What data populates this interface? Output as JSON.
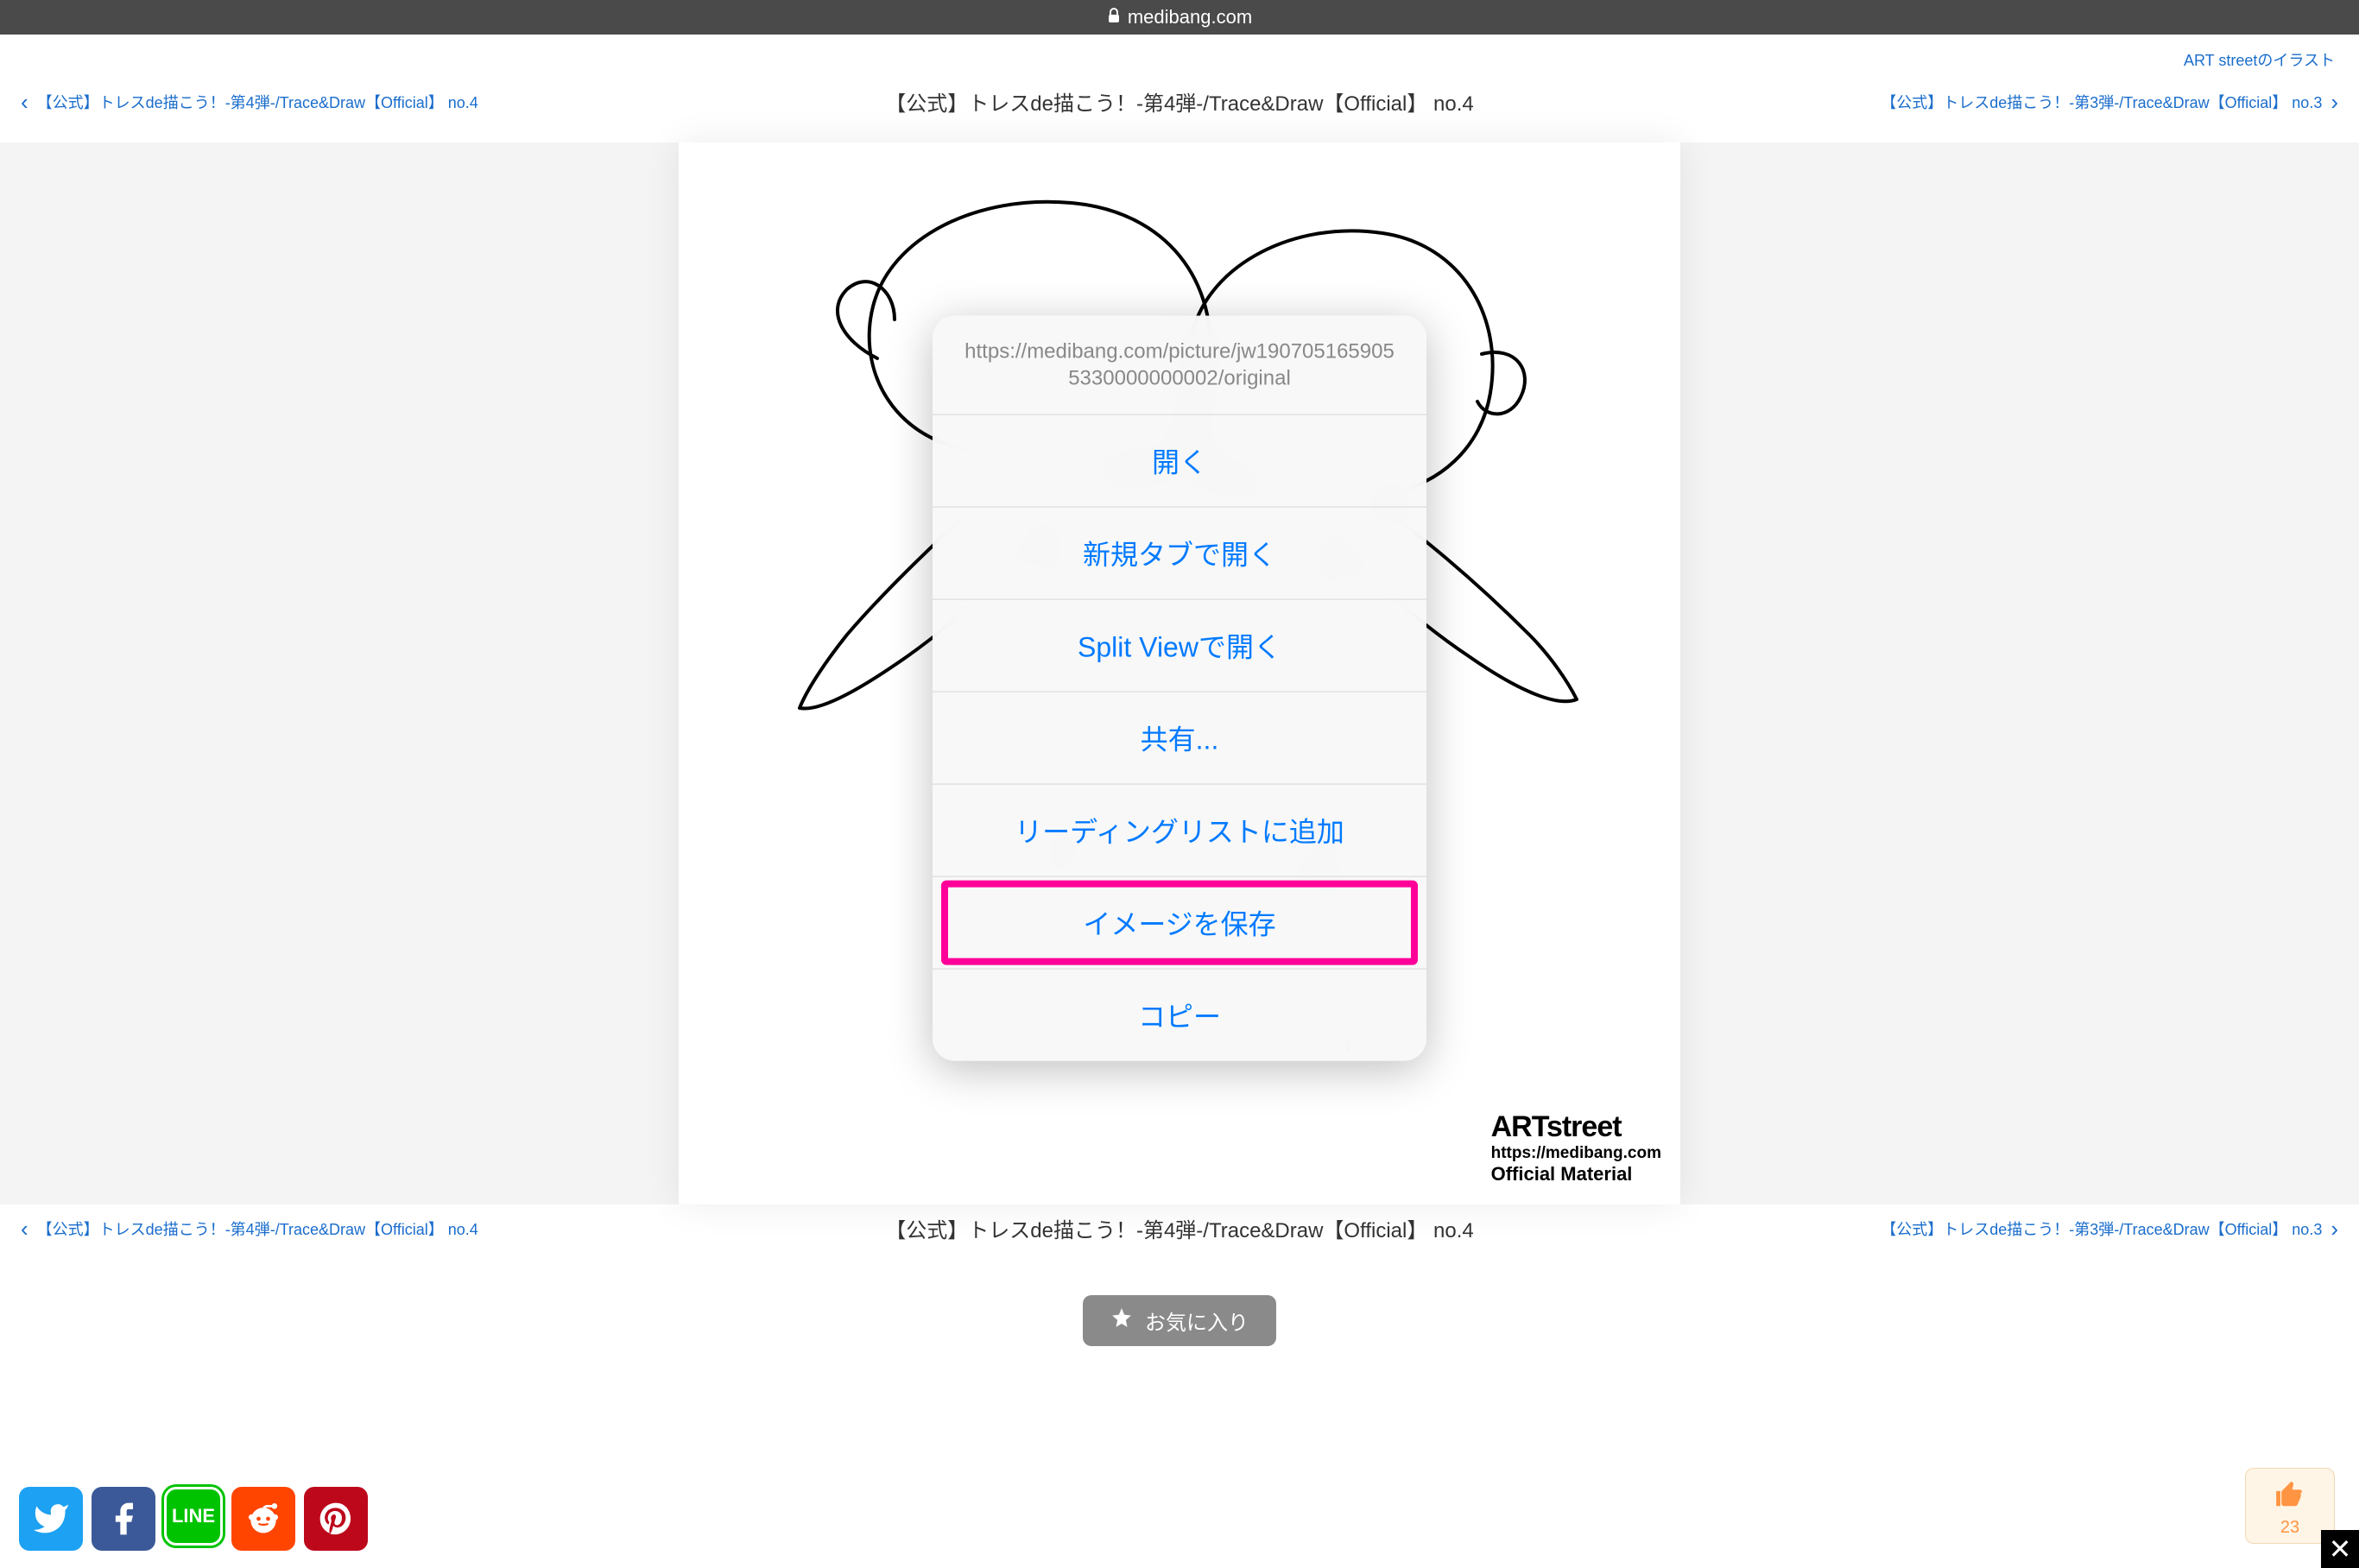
{
  "browser": {
    "domain": "medibang.com"
  },
  "header": {
    "top_link": "ART streetのイラスト"
  },
  "nav_top": {
    "prev": "【公式】トレスde描こう！-第4弾-/Trace&Draw【Official】 no.4",
    "title": "【公式】トレスde描こう！-第4弾-/Trace&Draw【Official】 no.4",
    "next": "【公式】トレスde描こう！-第3弾-/Trace&Draw【Official】 no.3"
  },
  "nav_bottom": {
    "prev": "【公式】トレスde描こう！-第4弾-/Trace&Draw【Official】 no.4",
    "title": "【公式】トレスde描こう！-第4弾-/Trace&Draw【Official】 no.4",
    "next": "【公式】トレスde描こう！-第3弾-/Trace&Draw【Official】 no.3"
  },
  "watermark": {
    "brand": "ARTstreet",
    "url": "https://medibang.com",
    "sub": "Official Material"
  },
  "context_menu": {
    "url": "https://medibang.com/picture/jw1907051659055330000000002/original",
    "items": {
      "open": "開く",
      "new_tab": "新規タブで開く",
      "split_view": "Split Viewで開く",
      "share": "共有...",
      "reading_list": "リーディングリストに追加",
      "save_image": "イメージを保存",
      "copy": "コピー"
    }
  },
  "favorite": {
    "label": "お気に入り"
  },
  "like": {
    "count": "23"
  },
  "social": {
    "line_label": "LINE"
  }
}
